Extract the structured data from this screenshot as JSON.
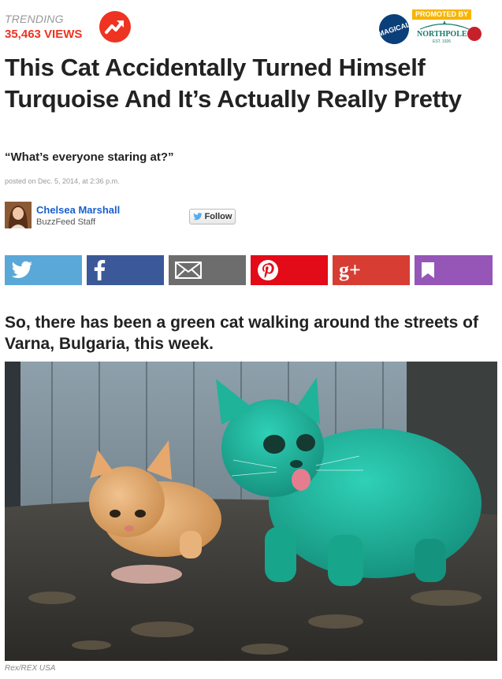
{
  "trending": {
    "label": "TRENDING",
    "views": "35,463 VIEWS"
  },
  "promo": {
    "badge_text": "MAGICAL",
    "promoted_by": "PROMOTED BY",
    "brand": "NORTHPOLE",
    "est": "EST. 1926"
  },
  "article": {
    "title": "This Cat Accidentally Turned Himself Turquoise And It’s Actually Really Pretty",
    "dek": "“What’s everyone staring at?”",
    "posted": "posted on Dec. 5, 2014, at 2:36 p.m."
  },
  "author": {
    "name": "Chelsea Marshall",
    "role": "BuzzFeed Staff",
    "follow_label": "Follow"
  },
  "share": {
    "buttons": [
      {
        "name": "twitter",
        "icon": "twitter-bird-icon",
        "color": "#5aa8d8"
      },
      {
        "name": "facebook",
        "icon": "facebook-f-icon",
        "color": "#3b5998"
      },
      {
        "name": "email",
        "icon": "envelope-icon",
        "color": "#6d6d6d"
      },
      {
        "name": "pinterest",
        "icon": "pinterest-p-icon",
        "color": "#e30b17"
      },
      {
        "name": "google-plus",
        "icon": "google-plus-icon",
        "color": "#d73d32"
      },
      {
        "name": "bookmark",
        "icon": "bookmark-icon",
        "color": "#9656b8"
      }
    ],
    "google_label": "g+"
  },
  "body": {
    "lead": "So, there has been a green cat walking around the streets of Varna, Bulgaria, this week.",
    "image_credit": "Rex/REX USA"
  }
}
